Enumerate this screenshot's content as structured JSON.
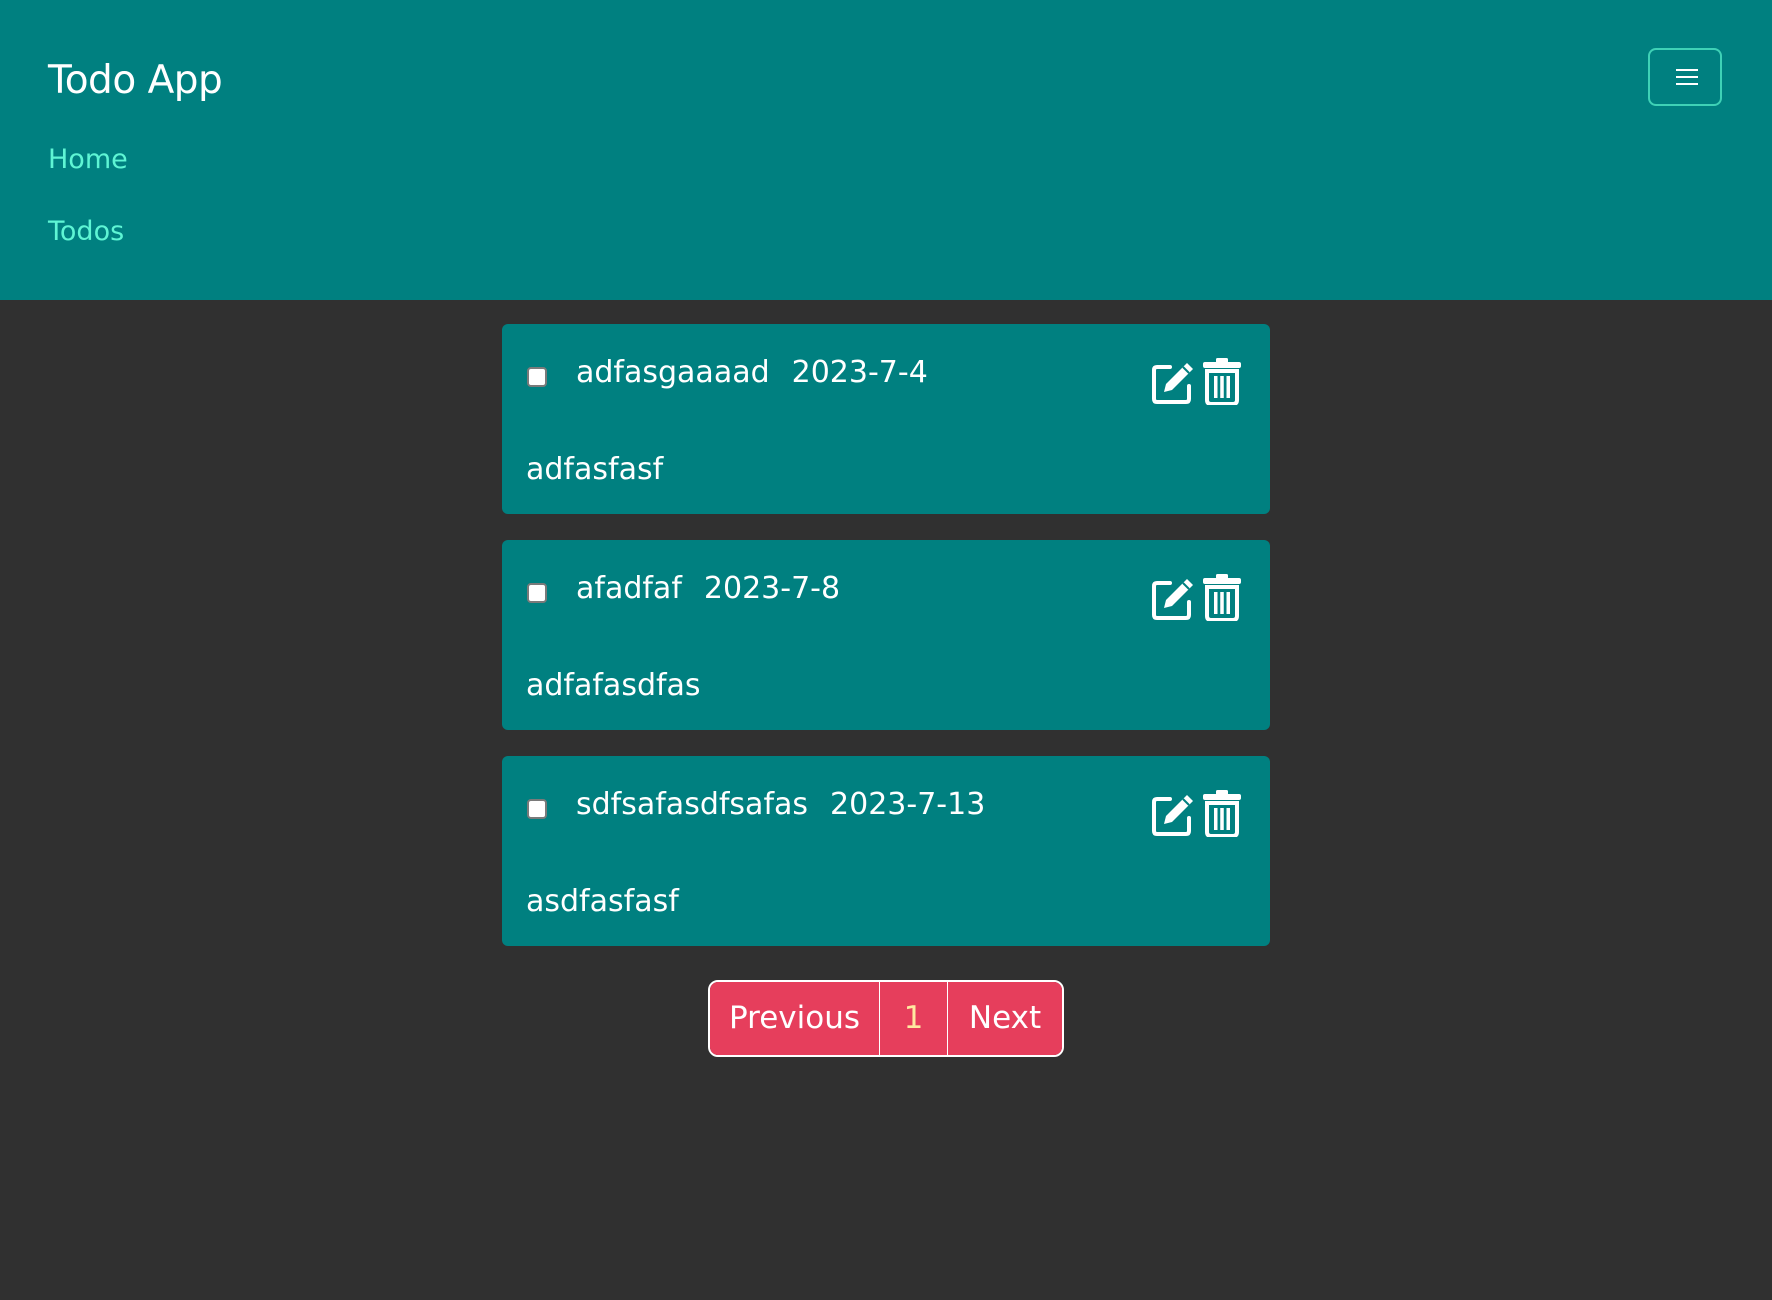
{
  "navbar": {
    "brand": "Todo App",
    "links": [
      "Home",
      "Todos"
    ],
    "toggler_icon": "hamburger-menu-icon",
    "accent_color": "#008080",
    "link_color": "#5ef5d4"
  },
  "todos": [
    {
      "title": "adfasgaaaad",
      "date": "2023-7-4",
      "description": "adfasfasf",
      "completed": false
    },
    {
      "title": "afadfaf",
      "date": "2023-7-8",
      "description": "adfafasdfas",
      "completed": false
    },
    {
      "title": "sdfsafasdfsafas",
      "date": "2023-7-13",
      "description": "asdfasfasf",
      "completed": false
    }
  ],
  "card_icons": {
    "edit": "edit-pencil-icon",
    "delete": "trash-icon"
  },
  "pagination": {
    "previous": "Previous",
    "current_page": "1",
    "next": "Next",
    "color": "#e63e5c"
  },
  "background_color": "#303030"
}
